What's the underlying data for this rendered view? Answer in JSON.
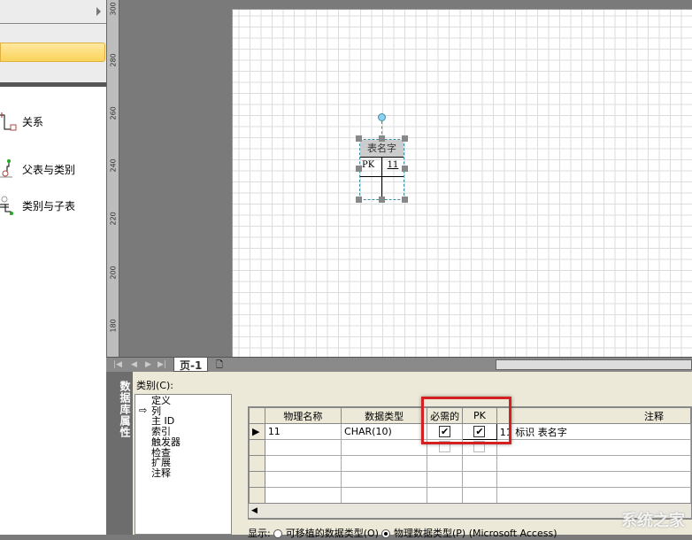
{
  "shapes_panel": {
    "items": [
      {
        "label": "关系",
        "icon": "relationship-icon"
      },
      {
        "label": "父表与类别",
        "icon": "parent-category-icon"
      },
      {
        "label": "类别与子表",
        "icon": "category-child-icon"
      }
    ]
  },
  "ruler": {
    "labels": [
      "300",
      "280",
      "260",
      "240",
      "220",
      "200",
      "180"
    ]
  },
  "diagram": {
    "entity": {
      "title": "表名字",
      "pk_label": "PK",
      "column": "11"
    }
  },
  "page_tabs": {
    "tab": "页-1"
  },
  "properties": {
    "title": "数据库属性",
    "category_label": "类别(C):",
    "categories": [
      "定义",
      "列",
      "主 ID",
      "索引",
      "触发器",
      "检查",
      "扩展",
      "注释"
    ],
    "selected_category": "列",
    "columns": [
      "物理名称",
      "数据类型",
      "必需的",
      "PK",
      "注释"
    ],
    "rows": [
      {
        "name": "11",
        "type": "CHAR(10)",
        "required": true,
        "pk": true,
        "comment": "11 标识 表名字"
      }
    ],
    "display_label": "显示:",
    "option_portable": "可移植的数据类型(O)",
    "option_physical": "物理数据类型(P)",
    "physical_selected": true,
    "db": "(Microsoft Access)"
  },
  "watermark": "系统之家"
}
